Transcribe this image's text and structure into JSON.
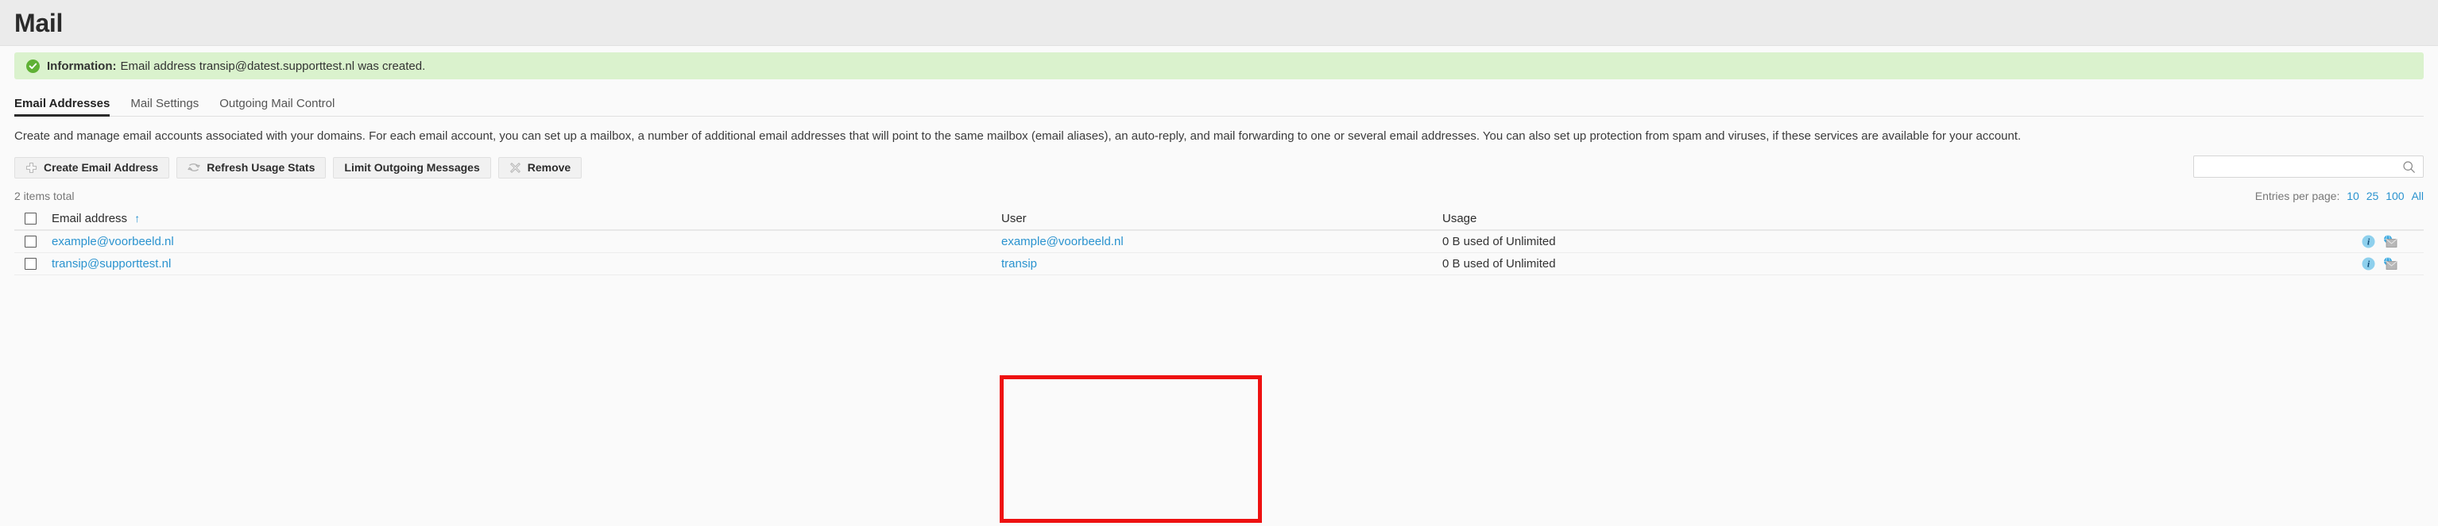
{
  "header": {
    "title": "Mail"
  },
  "banner": {
    "icon": "check-circle-icon",
    "label": "Information:",
    "message": "Email address transip@datest.supporttest.nl was created.",
    "background_color": "#daf2cd",
    "icon_color": "#5fb135"
  },
  "tabs": [
    {
      "label": "Email Addresses",
      "active": true
    },
    {
      "label": "Mail Settings",
      "active": false
    },
    {
      "label": "Outgoing Mail Control",
      "active": false
    }
  ],
  "description": "Create and manage email accounts associated with your domains. For each email account, you can set up a mailbox, a number of additional email addresses that will point to the same mailbox (email aliases), an auto-reply, and mail forwarding to one or several email addresses. You can also set up protection from spam and viruses, if these services are available for your account.",
  "toolbar": {
    "buttons": [
      {
        "label": "Create Email Address",
        "icon": "plus-icon"
      },
      {
        "label": "Refresh Usage Stats",
        "icon": "refresh-icon"
      },
      {
        "label": "Limit Outgoing Messages",
        "icon": ""
      },
      {
        "label": "Remove",
        "icon": "x-icon"
      }
    ],
    "search": {
      "value": "",
      "placeholder": "",
      "icon": "search-icon"
    }
  },
  "meta": {
    "items_total": "2 items total",
    "entries_label": "Entries per page:",
    "entries_options": [
      "10",
      "25",
      "100",
      "All"
    ]
  },
  "table": {
    "columns": {
      "email": "Email address",
      "user": "User",
      "usage": "Usage"
    },
    "sort_indicator": "↑",
    "rows": [
      {
        "email": "example@voorbeeld.nl",
        "user": "example@voorbeeld.nl",
        "usage": "0 B used of Unlimited"
      },
      {
        "email": "transip@supporttest.nl",
        "user": "transip",
        "usage": "0 B used of Unlimited"
      }
    ]
  },
  "annotation": {
    "color": "#ee1111",
    "target": "user-column"
  },
  "colors": {
    "link": "#2a93cf",
    "header_bg": "#ebebeb",
    "page_bg": "#fafafa"
  }
}
